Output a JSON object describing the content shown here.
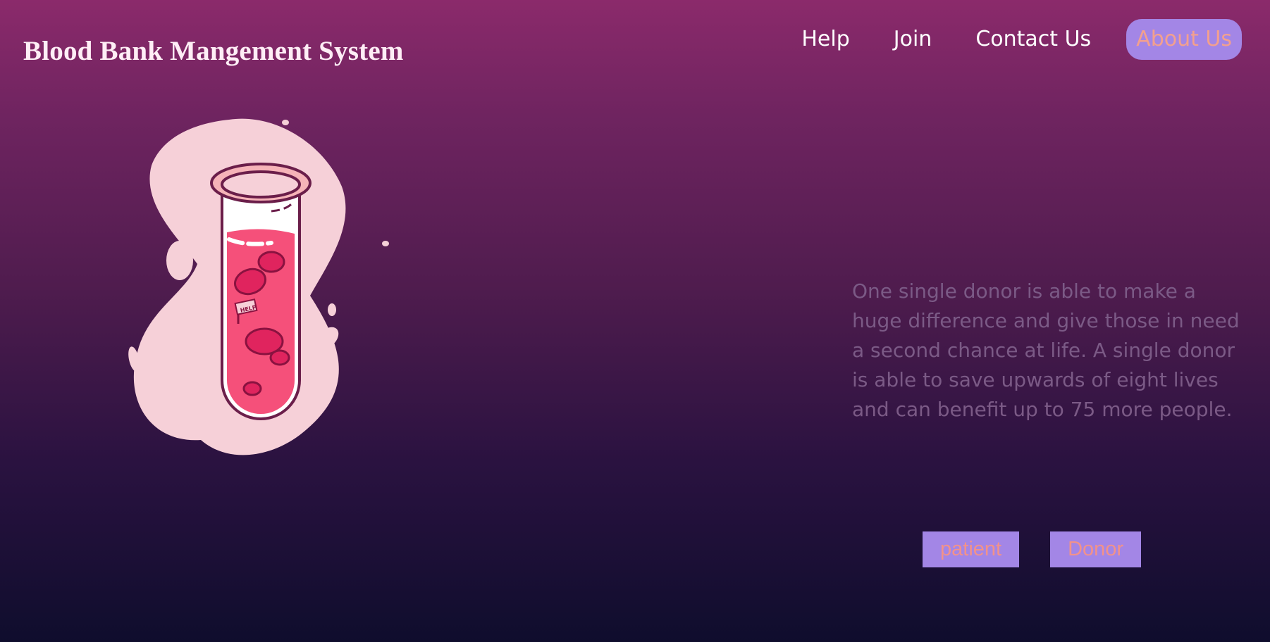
{
  "header": {
    "title": "Blood Bank Mangement System"
  },
  "nav": {
    "items": [
      {
        "label": "Help"
      },
      {
        "label": "Join"
      },
      {
        "label": "Contact Us"
      },
      {
        "label": "About Us",
        "active": true
      }
    ]
  },
  "hero": {
    "illustration_icon": "blood-test-tube-icon",
    "illustration_flag": "HELP",
    "tagline": "One single donor is able to make a huge difference and give those in need a second chance at life. A single donor is able to save upwards of eight lives and can benefit up to 75 more people."
  },
  "actions": {
    "patient_label": "patient",
    "donor_label": "Donor"
  },
  "colors": {
    "accent": "#a386e6",
    "accent_text": "#f2928a",
    "tagline_text": "#7b5a86",
    "blob": "#f6d0d8",
    "blood": "#f5507a"
  }
}
